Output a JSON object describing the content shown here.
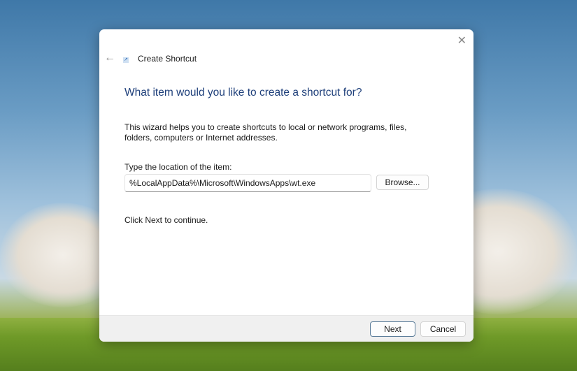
{
  "window": {
    "title": "Create Shortcut"
  },
  "main": {
    "heading": "What item would you like to create a shortcut for?",
    "description": "This wizard helps you to create shortcuts to local or network programs, files, folders, computers or Internet addresses.",
    "location_label": "Type the location of the item:",
    "location_value": "%LocalAppData%\\Microsoft\\WindowsApps\\wt.exe",
    "browse_label": "Browse...",
    "continue_text": "Click Next to continue."
  },
  "footer": {
    "next_label": "Next",
    "cancel_label": "Cancel"
  },
  "icons": {
    "back": "←",
    "close": "✕",
    "app": "↗"
  }
}
